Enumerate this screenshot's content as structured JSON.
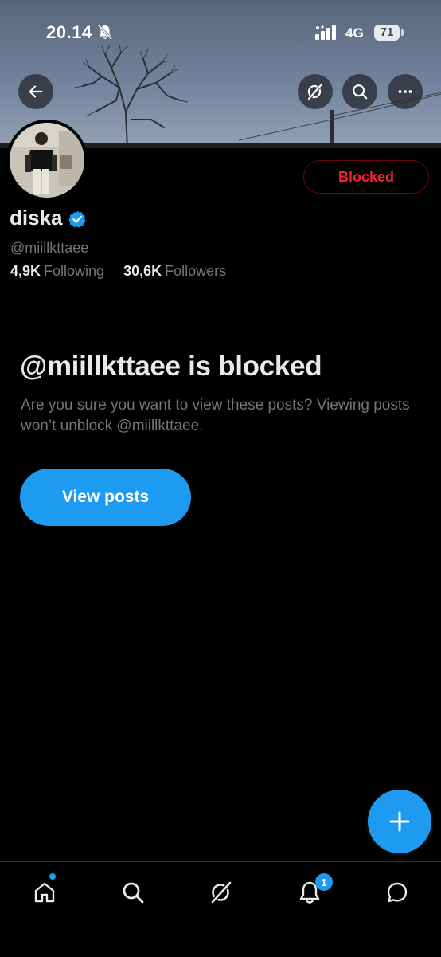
{
  "status_bar": {
    "time": "20.14",
    "network": "4G",
    "battery": "71"
  },
  "icons": {
    "back": "arrow-left-icon",
    "grok": "grok-icon",
    "search": "search-icon",
    "more": "more-icon",
    "verified": "verified-badge-icon",
    "compose": "plus-icon",
    "bell_off": "bell-off-icon",
    "signal": "signal-icon"
  },
  "colors": {
    "accent": "#1d9bf0",
    "blocked": "#f4212e",
    "muted": "#71767b",
    "background": "#000000"
  },
  "profile": {
    "blocked_label": "Blocked",
    "display_name": "diska",
    "handle": "@miillkttaee",
    "following_count": "4,9K",
    "following_label": "Following",
    "followers_count": "30,6K",
    "followers_label": "Followers"
  },
  "blocked_notice": {
    "title": "@miillkttaee is blocked",
    "description": "Are you sure you want to view these posts? Viewing posts won’t unblock @miillkttaee.",
    "button": "View posts"
  },
  "bottom_nav": {
    "items": [
      "home",
      "search",
      "grok",
      "notifications",
      "messages"
    ],
    "notification_count": "1"
  }
}
